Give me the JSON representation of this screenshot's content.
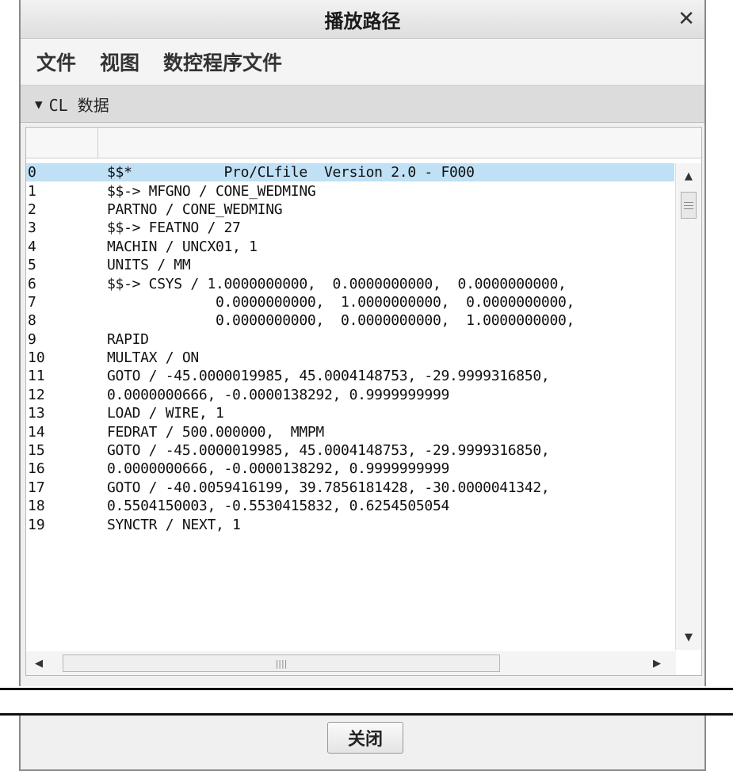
{
  "window": {
    "title": "播放路径",
    "close_symbol": "✕"
  },
  "menu": [
    "文件",
    "视图",
    "数控程序文件"
  ],
  "section": {
    "title": "CL 数据"
  },
  "cl_lines": [
    {
      "n": "0",
      "text": "$$*           Pro/CLfile  Version 2.0 - F000",
      "selected": true
    },
    {
      "n": "1",
      "text": "$$-> MFGNO / CONE_WEDMING"
    },
    {
      "n": "2",
      "text": "PARTNO / CONE_WEDMING"
    },
    {
      "n": "3",
      "text": "$$-> FEATNO / 27"
    },
    {
      "n": "4",
      "text": "MACHIN / UNCX01, 1"
    },
    {
      "n": "5",
      "text": "UNITS / MM"
    },
    {
      "n": "6",
      "text": "$$-> CSYS / 1.0000000000,  0.0000000000,  0.0000000000,"
    },
    {
      "n": "7",
      "text": "             0.0000000000,  1.0000000000,  0.0000000000,"
    },
    {
      "n": "8",
      "text": "             0.0000000000,  0.0000000000,  1.0000000000,"
    },
    {
      "n": "9",
      "text": "RAPID"
    },
    {
      "n": "10",
      "text": "MULTAX / ON"
    },
    {
      "n": "11",
      "text": "GOTO / -45.0000019985, 45.0004148753, -29.9999316850,"
    },
    {
      "n": "12",
      "text": "0.0000000666, -0.0000138292, 0.9999999999"
    },
    {
      "n": "13",
      "text": "LOAD / WIRE, 1"
    },
    {
      "n": "14",
      "text": "FEDRAT / 500.000000,  MMPM"
    },
    {
      "n": "15",
      "text": "GOTO / -45.0000019985, 45.0004148753, -29.9999316850,"
    },
    {
      "n": "16",
      "text": "0.0000000666, -0.0000138292, 0.9999999999"
    },
    {
      "n": "17",
      "text": "GOTO / -40.0059416199, 39.7856181428, -30.0000041342,"
    },
    {
      "n": "18",
      "text": "0.5504150003, -0.5530415832, 0.6254505054"
    },
    {
      "n": "19",
      "text": "SYNCTR / NEXT, 1"
    }
  ],
  "footer": {
    "close_label": "关闭"
  },
  "colors": {
    "selected_row": "#bfe0f5",
    "section_bg": "#dcdcdc"
  }
}
